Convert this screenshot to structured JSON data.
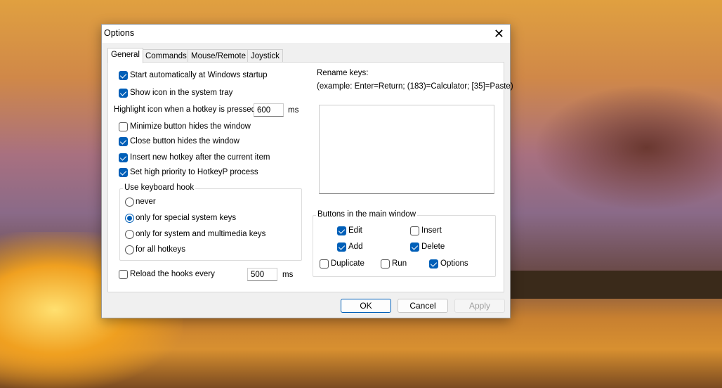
{
  "window": {
    "title": "Options"
  },
  "tabs": [
    "General",
    "Commands",
    "Mouse/Remote",
    "Joystick"
  ],
  "general": {
    "start_auto": {
      "label": "Start automatically at Windows startup",
      "checked": true
    },
    "show_icon": {
      "label": "Show icon in the system tray",
      "checked": true
    },
    "highlight_label": "Highlight icon when a hotkey is pressed:",
    "highlight_value": "600",
    "highlight_unit": "ms",
    "minimize_hides": {
      "label": "Minimize button hides the window",
      "checked": false
    },
    "close_hides": {
      "label": "Close button hides the window",
      "checked": true
    },
    "insert_after": {
      "label": "Insert new hotkey after the current item",
      "checked": true
    },
    "high_priority": {
      "label": "Set high priority to HotkeyP process",
      "checked": true
    },
    "hook_group": {
      "label": "Use keyboard hook",
      "options": [
        "never",
        "only for special system keys",
        "only for system and multimedia keys",
        "for all hotkeys"
      ],
      "selected": 1
    },
    "reload": {
      "label": "Reload the hooks every",
      "checked": false,
      "value": "500",
      "unit": "ms"
    },
    "rename": {
      "label": "Rename keys:",
      "example": "(example:  Enter=Return; (183)=Calculator; [35]=Paste)",
      "value": ""
    },
    "buttons_group": {
      "label": "Buttons in the main window",
      "edit": "Edit",
      "insert": "Insert",
      "add": "Add",
      "delete": "Delete",
      "duplicate": "Duplicate",
      "run": "Run",
      "options": "Options"
    }
  },
  "footer": {
    "ok": "OK",
    "cancel": "Cancel",
    "apply": "Apply"
  },
  "colors": {
    "accent": "#005fb8"
  }
}
